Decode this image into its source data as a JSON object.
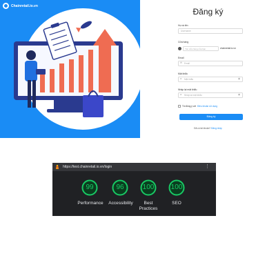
{
  "brand": {
    "name": "Chainretail.io.vn"
  },
  "form": {
    "title": "Đăng ký",
    "fields": [
      {
        "label": "Họ và tên",
        "placeholder": "Username"
      },
      {
        "label": "Cửa hàng",
        "placeholder": "Tên cửa hàng của bạn",
        "suffix": "chainretail.io.vn"
      },
      {
        "label": "Email",
        "placeholder": "Email"
      },
      {
        "label": "Mật khẩu",
        "placeholder": "Mật khẩu"
      },
      {
        "label": "Nhập lại mật khẩu",
        "placeholder": "Nhập lại mật khẩu"
      }
    ],
    "terms_text": "Tôi đồng ý với",
    "terms_link": "Điều khoản sử dụng",
    "submit_label": "Đăng ký",
    "login_prompt": "Đã có tài khoản?",
    "login_link": "Đăng nhập"
  },
  "lighthouse": {
    "url": "https://test.chainretail.io.vn/login",
    "scores": [
      {
        "label": "Performance",
        "value": "99"
      },
      {
        "label": "Accessibility",
        "value": "96"
      },
      {
        "label": "Best Practices",
        "value": "100"
      },
      {
        "label": "SEO",
        "value": "100"
      }
    ],
    "score_color": "#18c964"
  },
  "colors": {
    "primary": "#1a8cf5",
    "panel": "#202124"
  }
}
